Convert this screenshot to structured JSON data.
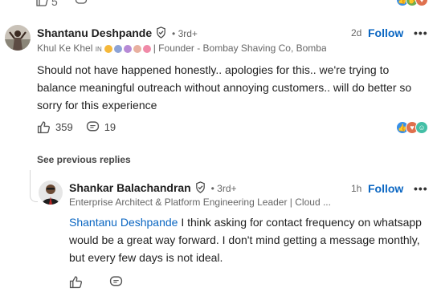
{
  "top": {
    "like_count": "5"
  },
  "comment1": {
    "author": "Shantanu Deshpande",
    "degree": "• 3rd+",
    "subtitle_prefix": "Khul Ke Khel",
    "subtitle_badge": "IN",
    "subtitle_suffix": "| Founder - Bombay Shaving Co, Bomba...",
    "time": "2d",
    "follow_label": "Follow",
    "more_label": "•••",
    "text": "Should not have happened honestly.. apologies for this.. we're trying to balance meaningful outreach without annoying customers.. will do better so sorry for this experience",
    "like_count": "359",
    "reply_count": "19"
  },
  "see_previous": "See previous replies",
  "comment2": {
    "author": "Shankar Balachandran",
    "degree": "• 3rd+",
    "subtitle": "Enterprise Architect & Platform Engineering Leader | Cloud ...",
    "time": "1h",
    "follow_label": "Follow",
    "more_label": "•••",
    "mention": "Shantanu Deshpande",
    "text": " I think asking for contact frequency on whatsapp would be a great way forward. I don't mind getting a message monthly, but every few days is not ideal."
  },
  "colors": {
    "link": "#0a66c2",
    "text": "#1f1f1f",
    "muted": "#666666"
  },
  "icons": [
    "like-icon",
    "comment-icon",
    "verified-icon",
    "reaction-like-icon",
    "reaction-celebrate-icon",
    "reaction-love-icon",
    "reaction-funny-icon"
  ]
}
